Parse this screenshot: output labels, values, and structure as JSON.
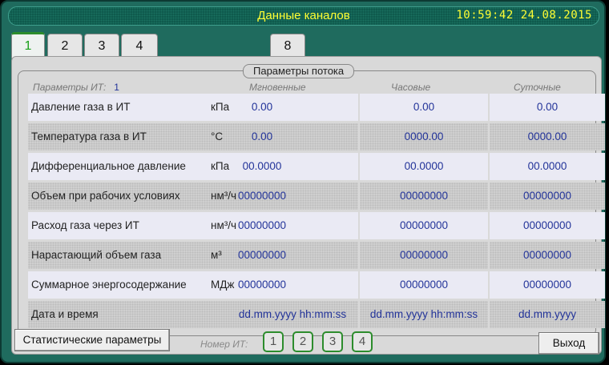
{
  "header": {
    "title": "Данные каналов",
    "clock": "10:59:42  24.08.2015"
  },
  "tabs": [
    {
      "label": "1",
      "active": true
    },
    {
      "label": "2"
    },
    {
      "label": "3"
    },
    {
      "label": "4"
    },
    {
      "label": "8"
    }
  ],
  "section": {
    "title": "Параметры потока"
  },
  "params": {
    "label": "Параметры ИТ:",
    "value": "1"
  },
  "columns": {
    "instant": "Мгновенные",
    "hourly": "Часовые",
    "daily": "Суточные"
  },
  "rows": [
    {
      "name": "Давление газа в ИТ",
      "unit": "кПа",
      "instant": "0.00",
      "hourly": "0.00",
      "daily": "0.00"
    },
    {
      "name": "Температура газа в ИТ",
      "unit": "°C",
      "instant": "0.00",
      "hourly": "0000.00",
      "daily": "0000.00"
    },
    {
      "name": "Дифференциальное давление",
      "unit": "кПа",
      "instant": "00.0000",
      "hourly": "00.0000",
      "daily": "00.0000"
    },
    {
      "name": "Объем при рабочих условиях",
      "unit": "нм³/ч",
      "instant": "00000000",
      "hourly": "00000000",
      "daily": "00000000"
    },
    {
      "name": "Расход газа через ИТ",
      "unit": "нм³/ч",
      "instant": "00000000",
      "hourly": "00000000",
      "daily": "00000000"
    },
    {
      "name": "Нарастающий объем газа",
      "unit": "м³",
      "instant": "00000000",
      "hourly": "00000000",
      "daily": "00000000"
    },
    {
      "name": "Суммарное энергосодержание",
      "unit": "МДж",
      "instant": "00000000",
      "hourly": "00000000",
      "daily": "00000000"
    },
    {
      "name": "Дата и время",
      "unit": "",
      "instant": "dd.mm.yyyy  hh:mm:ss",
      "hourly": "dd.mm.yyyy  hh:mm:ss",
      "daily": "dd.mm.yyyy"
    }
  ],
  "footer": {
    "stats_button": "Статистические параметры",
    "it_number_label": "Номер ИТ:",
    "it_buttons": [
      "1",
      "2",
      "3",
      "4"
    ],
    "exit_button": "Выход"
  },
  "colors": {
    "title_text": "#ffff33",
    "frame": "#1f6b5e",
    "value_text": "#223399",
    "active_tab": "#18a018"
  }
}
